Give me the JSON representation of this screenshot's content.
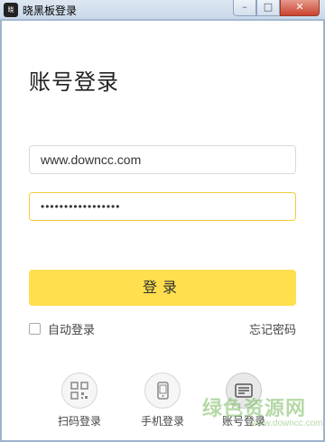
{
  "window": {
    "title": "晓黑板登录",
    "app_icon": "晓",
    "minimize_symbol": "–",
    "maximize_symbol": "□",
    "close_symbol": "✕"
  },
  "login": {
    "heading": "账号登录",
    "username_value": "www.downcc.com",
    "password_value": "•••••••••••••••••",
    "login_button": "登录",
    "auto_login_label": "自动登录",
    "auto_login_checked": false,
    "forgot_password": "忘记密码"
  },
  "methods": [
    {
      "label": "扫码登录",
      "icon": "qr-code-icon",
      "active": false
    },
    {
      "label": "手机登录",
      "icon": "phone-icon",
      "active": false
    },
    {
      "label": "账号登录",
      "icon": "account-card-icon",
      "active": true
    }
  ],
  "watermark": {
    "text": "绿色资源网",
    "sub": "www.downcc.com"
  },
  "colors": {
    "accent": "#ffdf4d",
    "focus_border": "#f0cc3a",
    "watermark": "#78b95f"
  }
}
